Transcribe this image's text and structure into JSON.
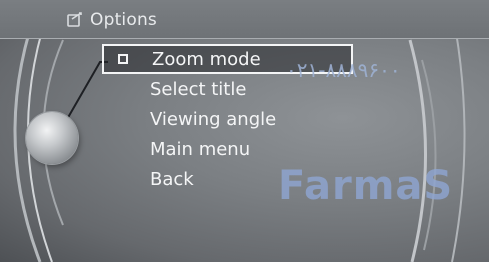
{
  "header": {
    "title": "Options",
    "icon": "options-icon"
  },
  "menu": {
    "items": [
      {
        "label": "Zoom mode",
        "selected": true,
        "has_checkbox": true
      },
      {
        "label": "Select title"
      },
      {
        "label": "Viewing angle"
      },
      {
        "label": "Main menu"
      },
      {
        "label": "Back"
      }
    ]
  },
  "watermark": {
    "phone": "۰۲۱-۸۸۸۹۶۰۰",
    "brand": "FarmaS"
  },
  "colors": {
    "text": "#f4f5f6",
    "background": "#7b7f83",
    "watermark": "#8fa6d3"
  }
}
